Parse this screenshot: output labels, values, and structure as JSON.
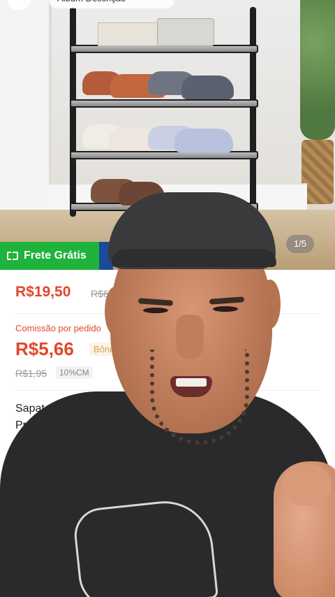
{
  "header": {
    "album_pill": "Álbum   Descrição"
  },
  "product_image": {
    "counter": "1/5"
  },
  "badge": {
    "frete_label": "Frete Grátis"
  },
  "pricing": {
    "price": "R$19,50",
    "old_price": "R$6",
    "commission_label": "Comissão por pedido",
    "commission_value": "R$5,66",
    "bonus_label": "Bônus",
    "commission_old": "R$1,95",
    "commission_rate": "10%CM"
  },
  "product": {
    "title_line1": "Sapateira de",
    "title_line2": "Prat"
  },
  "colors": {
    "accent_red": "#e2462a",
    "frete_green": "#1fb33b"
  }
}
